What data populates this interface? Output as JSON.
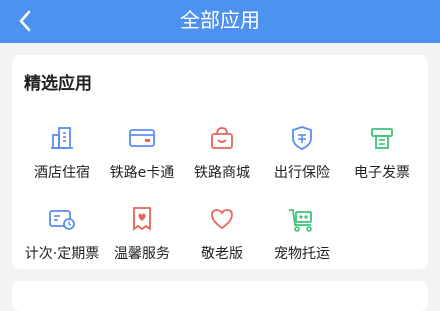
{
  "header": {
    "title": "全部应用",
    "back_icon": "chevron-left-icon"
  },
  "section": {
    "title": "精选应用",
    "apps": [
      {
        "label": "酒店住宿",
        "icon": "hotel-building-icon"
      },
      {
        "label": "铁路e卡通",
        "icon": "railway-card-icon"
      },
      {
        "label": "铁路商城",
        "icon": "shop-basket-icon"
      },
      {
        "label": "出行保险",
        "icon": "insurance-shield-icon"
      },
      {
        "label": "电子发票",
        "icon": "e-invoice-printer-icon"
      },
      {
        "label": "计次·定期票",
        "icon": "timed-ticket-icon"
      },
      {
        "label": "温馨服务",
        "icon": "warm-service-heart-icon"
      },
      {
        "label": "敬老版",
        "icon": "elder-heart-icon"
      },
      {
        "label": "宠物托运",
        "icon": "pet-cart-icon"
      }
    ]
  },
  "colors": {
    "header": "#4e92f1",
    "blue": "#5b8ef0",
    "red": "#e8655c",
    "green": "#3ec27a"
  }
}
